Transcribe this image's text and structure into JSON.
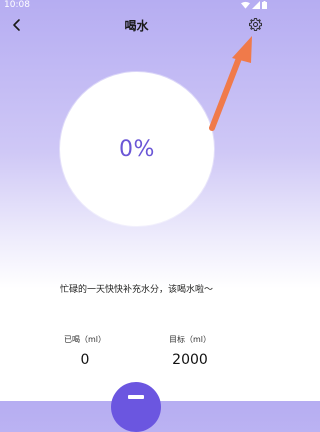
{
  "status_bar": {
    "time": "10:08"
  },
  "header": {
    "title": "喝水"
  },
  "progress": {
    "percent_text": "0%",
    "value": 0
  },
  "message": "忙碌的一天快快补充水分，该喝水啦～",
  "stats": {
    "drank_label": "已喝（ml）",
    "drank_value": "0",
    "target_label": "目标（ml）",
    "target_value": "2000"
  },
  "colors": {
    "accent": "#6b56e0",
    "annotation_arrow": "#f07a4a"
  },
  "icons": {
    "back": "chevron-left-icon",
    "settings": "gear-icon"
  }
}
